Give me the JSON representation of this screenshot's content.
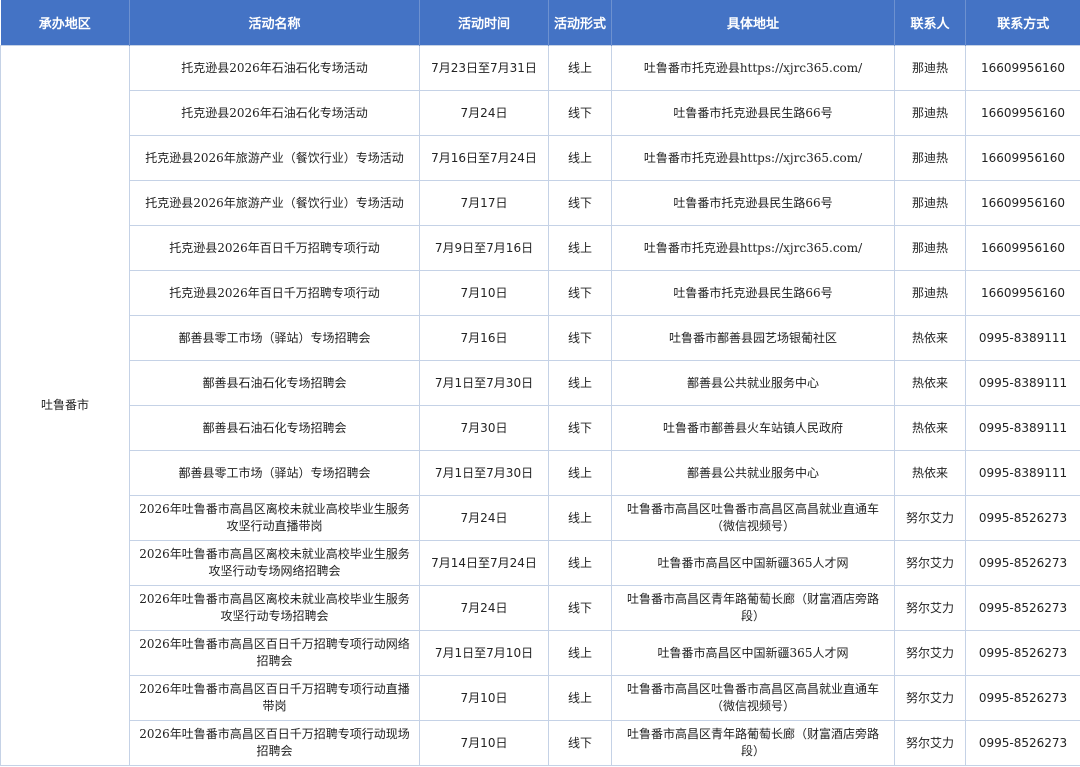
{
  "headers": [
    "承办地区",
    "活动名称",
    "活动时间",
    "活动形式",
    "具体地址",
    "联系人",
    "联系方式"
  ],
  "region": "吐鲁番市",
  "rows": [
    {
      "name": "托克逊县2026年石油石化专场活动",
      "time": "7月23日至7月31日",
      "form": "线上",
      "address": "吐鲁番市托克逊县https://xjrc365.com/",
      "contact": "那迪热",
      "phone": "16609956160"
    },
    {
      "name": "托克逊县2026年石油石化专场活动",
      "time": "7月24日",
      "form": "线下",
      "address": "吐鲁番市托克逊县民生路66号",
      "contact": "那迪热",
      "phone": "16609956160"
    },
    {
      "name": "托克逊县2026年旅游产业（餐饮行业）专场活动",
      "time": "7月16日至7月24日",
      "form": "线上",
      "address": "吐鲁番市托克逊县https://xjrc365.com/",
      "contact": "那迪热",
      "phone": "16609956160"
    },
    {
      "name": "托克逊县2026年旅游产业（餐饮行业）专场活动",
      "time": "7月17日",
      "form": "线下",
      "address": "吐鲁番市托克逊县民生路66号",
      "contact": "那迪热",
      "phone": "16609956160"
    },
    {
      "name": "托克逊县2026年百日千万招聘专项行动",
      "time": "7月9日至7月16日",
      "form": "线上",
      "address": "吐鲁番市托克逊县https://xjrc365.com/",
      "contact": "那迪热",
      "phone": "16609956160"
    },
    {
      "name": "托克逊县2026年百日千万招聘专项行动",
      "time": "7月10日",
      "form": "线下",
      "address": "吐鲁番市托克逊县民生路66号",
      "contact": "那迪热",
      "phone": "16609956160"
    },
    {
      "name": "鄯善县零工市场（驿站）专场招聘会",
      "time": "7月16日",
      "form": "线下",
      "address": "吐鲁番市鄯善县园艺场银葡社区",
      "contact": "热依来",
      "phone": "0995-8389111"
    },
    {
      "name": "鄯善县石油石化专场招聘会",
      "time": "7月1日至7月30日",
      "form": "线上",
      "address": "鄯善县公共就业服务中心",
      "contact": "热依来",
      "phone": "0995-8389111"
    },
    {
      "name": "鄯善县石油石化专场招聘会",
      "time": "7月30日",
      "form": "线下",
      "address": "吐鲁番市鄯善县火车站镇人民政府",
      "contact": "热依来",
      "phone": "0995-8389111"
    },
    {
      "name": "鄯善县零工市场（驿站）专场招聘会",
      "time": "7月1日至7月30日",
      "form": "线上",
      "address": "鄯善县公共就业服务中心",
      "contact": "热依来",
      "phone": "0995-8389111"
    },
    {
      "name": "2026年吐鲁番市高昌区离校未就业高校毕业生服务攻坚行动直播带岗",
      "time": "7月24日",
      "form": "线上",
      "address": "吐鲁番市高昌区吐鲁番市高昌区高昌就业直通车（微信视频号）",
      "contact": "努尔艾力",
      "phone": "0995-8526273"
    },
    {
      "name": "2026年吐鲁番市高昌区离校未就业高校毕业生服务攻坚行动专场网络招聘会",
      "time": "7月14日至7月24日",
      "form": "线上",
      "address": "吐鲁番市高昌区中国新疆365人才网",
      "contact": "努尔艾力",
      "phone": "0995-8526273"
    },
    {
      "name": "2026年吐鲁番市高昌区离校未就业高校毕业生服务攻坚行动专场招聘会",
      "time": "7月24日",
      "form": "线下",
      "address": "吐鲁番市高昌区青年路葡萄长廊（财富酒店旁路段）",
      "contact": "努尔艾力",
      "phone": "0995-8526273"
    },
    {
      "name": "2026年吐鲁番市高昌区百日千万招聘专项行动网络招聘会",
      "time": "7月1日至7月10日",
      "form": "线上",
      "address": "吐鲁番市高昌区中国新疆365人才网",
      "contact": "努尔艾力",
      "phone": "0995-8526273"
    },
    {
      "name": "2026年吐鲁番市高昌区百日千万招聘专项行动直播带岗",
      "time": "7月10日",
      "form": "线上",
      "address": "吐鲁番市高昌区吐鲁番市高昌区高昌就业直通车（微信视频号）",
      "contact": "努尔艾力",
      "phone": "0995-8526273"
    },
    {
      "name": "2026年吐鲁番市高昌区百日千万招聘专项行动现场招聘会",
      "time": "7月10日",
      "form": "线下",
      "address": "吐鲁番市高昌区青年路葡萄长廊（财富酒店旁路段）",
      "contact": "努尔艾力",
      "phone": "0995-8526273"
    }
  ]
}
